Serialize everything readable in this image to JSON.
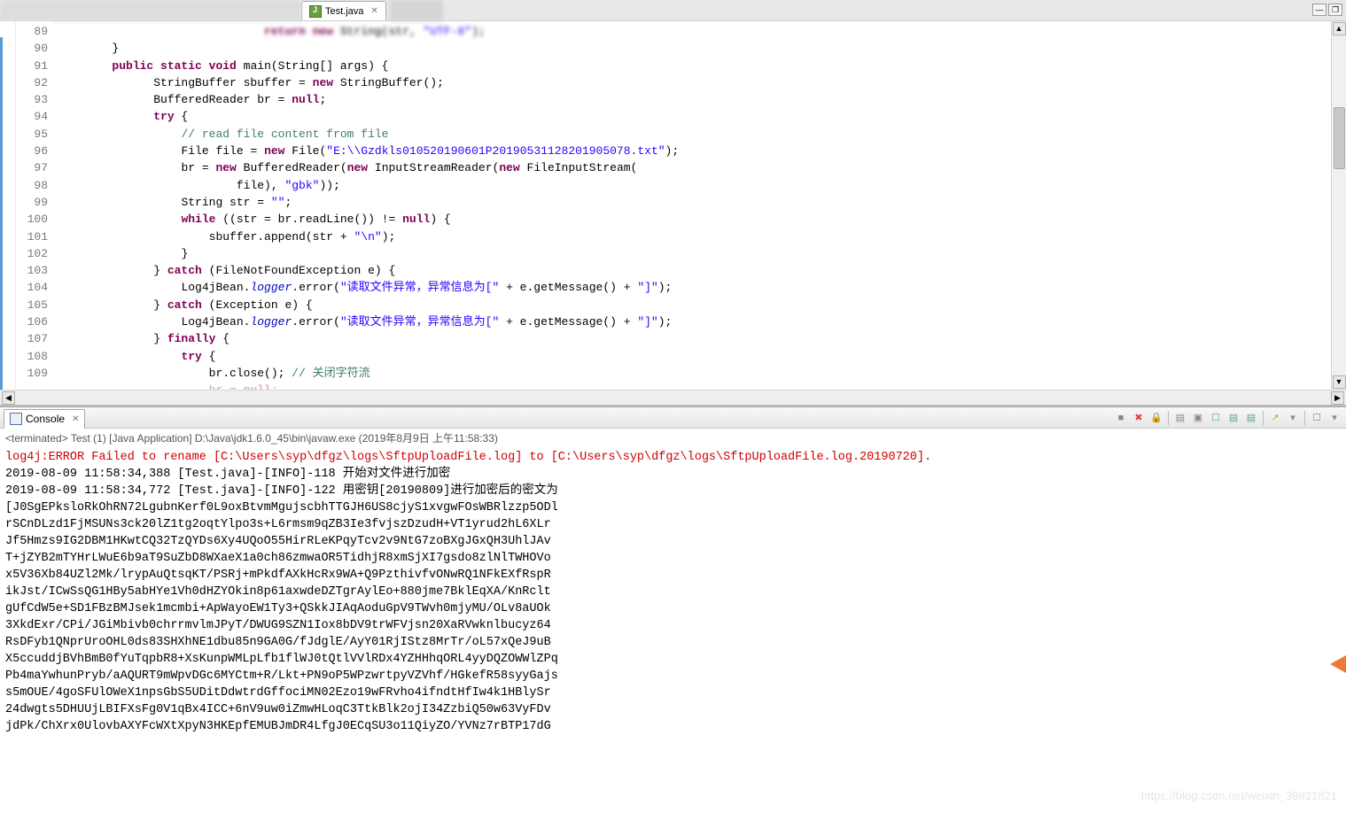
{
  "tab": {
    "filename": "Test.java",
    "close_glyph": "✕"
  },
  "window_controls": {
    "minimize": "—",
    "restore": "❐"
  },
  "editor": {
    "line_numbers": [
      "",
      "89",
      "90",
      "91",
      "92",
      "93",
      "94",
      "95",
      "96",
      "97",
      "98",
      "99",
      "100",
      "101",
      "102",
      "103",
      "104",
      "105",
      "106",
      "107",
      "108",
      "109"
    ],
    "lines": [
      {
        "indent": 24,
        "tokens": [
          {
            "t": "kw",
            "v": "return new"
          },
          {
            "t": "",
            "v": " String(str, "
          },
          {
            "t": "str",
            "v": "\"UTF-8\""
          },
          {
            "t": "",
            "v": ");"
          }
        ],
        "blurred": true
      },
      {
        "indent": 2,
        "tokens": [
          {
            "t": "",
            "v": "}"
          }
        ]
      },
      {
        "indent": 2,
        "tokens": [
          {
            "t": "kw",
            "v": "public static void"
          },
          {
            "t": "",
            "v": " main(String[] args) {"
          }
        ]
      },
      {
        "indent": 8,
        "tokens": [
          {
            "t": "",
            "v": "StringBuffer sbuffer = "
          },
          {
            "t": "kw",
            "v": "new"
          },
          {
            "t": "",
            "v": " StringBuffer();"
          }
        ]
      },
      {
        "indent": 8,
        "tokens": [
          {
            "t": "",
            "v": "BufferedReader br = "
          },
          {
            "t": "kw",
            "v": "null"
          },
          {
            "t": "",
            "v": ";"
          }
        ]
      },
      {
        "indent": 8,
        "tokens": [
          {
            "t": "kw",
            "v": "try"
          },
          {
            "t": "",
            "v": " {"
          }
        ]
      },
      {
        "indent": 12,
        "tokens": [
          {
            "t": "cm",
            "v": "// read file content from file"
          }
        ]
      },
      {
        "indent": 12,
        "tokens": [
          {
            "t": "",
            "v": "File file = "
          },
          {
            "t": "kw",
            "v": "new"
          },
          {
            "t": "",
            "v": " File("
          },
          {
            "t": "str",
            "v": "\"E:\\\\Gzdkls010520190601P20190531128201905078.txt\""
          },
          {
            "t": "",
            "v": ");"
          }
        ]
      },
      {
        "indent": 12,
        "tokens": [
          {
            "t": "",
            "v": "br = "
          },
          {
            "t": "kw",
            "v": "new"
          },
          {
            "t": "",
            "v": " BufferedReader("
          },
          {
            "t": "kw",
            "v": "new"
          },
          {
            "t": "",
            "v": " InputStreamReader("
          },
          {
            "t": "kw",
            "v": "new"
          },
          {
            "t": "",
            "v": " FileInputStream("
          }
        ]
      },
      {
        "indent": 20,
        "tokens": [
          {
            "t": "",
            "v": "file), "
          },
          {
            "t": "str",
            "v": "\"gbk\""
          },
          {
            "t": "",
            "v": "));"
          }
        ]
      },
      {
        "indent": 12,
        "tokens": [
          {
            "t": "",
            "v": "String str = "
          },
          {
            "t": "str",
            "v": "\"\""
          },
          {
            "t": "",
            "v": ";"
          }
        ]
      },
      {
        "indent": 12,
        "tokens": [
          {
            "t": "kw",
            "v": "while"
          },
          {
            "t": "",
            "v": " ((str = br.readLine()) != "
          },
          {
            "t": "kw",
            "v": "null"
          },
          {
            "t": "",
            "v": ") {"
          }
        ]
      },
      {
        "indent": 16,
        "tokens": [
          {
            "t": "",
            "v": "sbuffer.append(str + "
          },
          {
            "t": "str",
            "v": "\"\\n\""
          },
          {
            "t": "",
            "v": ");"
          }
        ]
      },
      {
        "indent": 12,
        "tokens": [
          {
            "t": "",
            "v": "}"
          }
        ]
      },
      {
        "indent": 8,
        "tokens": [
          {
            "t": "",
            "v": "} "
          },
          {
            "t": "kw",
            "v": "catch"
          },
          {
            "t": "",
            "v": " (FileNotFoundException e) {"
          }
        ]
      },
      {
        "indent": 12,
        "tokens": [
          {
            "t": "",
            "v": "Log4jBean."
          },
          {
            "t": "fld",
            "v": "logger"
          },
          {
            "t": "",
            "v": ".error("
          },
          {
            "t": "str",
            "v": "\"读取文件异常，异常信息为[\""
          },
          {
            "t": "",
            "v": " + e.getMessage() + "
          },
          {
            "t": "str",
            "v": "\"]\""
          },
          {
            "t": "",
            "v": ");"
          }
        ]
      },
      {
        "indent": 8,
        "tokens": [
          {
            "t": "",
            "v": "} "
          },
          {
            "t": "kw",
            "v": "catch"
          },
          {
            "t": "",
            "v": " (Exception e) {"
          }
        ]
      },
      {
        "indent": 12,
        "tokens": [
          {
            "t": "",
            "v": "Log4jBean."
          },
          {
            "t": "fld",
            "v": "logger"
          },
          {
            "t": "",
            "v": ".error("
          },
          {
            "t": "str",
            "v": "\"读取文件异常，异常信息为[\""
          },
          {
            "t": "",
            "v": " + e.getMessage() + "
          },
          {
            "t": "str",
            "v": "\"]\""
          },
          {
            "t": "",
            "v": ");"
          }
        ]
      },
      {
        "indent": 8,
        "tokens": [
          {
            "t": "",
            "v": "} "
          },
          {
            "t": "kw",
            "v": "finally"
          },
          {
            "t": "",
            "v": " {"
          }
        ]
      },
      {
        "indent": 12,
        "tokens": [
          {
            "t": "kw",
            "v": "try"
          },
          {
            "t": "",
            "v": " {"
          }
        ]
      },
      {
        "indent": 16,
        "tokens": [
          {
            "t": "",
            "v": "br.close(); "
          },
          {
            "t": "cm",
            "v": "// 关闭字符流"
          }
        ]
      },
      {
        "indent": 16,
        "tokens": [
          {
            "t": "",
            "v": "br = "
          },
          {
            "t": "kw",
            "v": "null"
          },
          {
            "t": "",
            "v": ";"
          }
        ],
        "faded": true
      }
    ]
  },
  "console": {
    "tab_label": "Console",
    "close_glyph": "✕",
    "status": "<terminated> Test (1) [Java Application] D:\\Java\\jdk1.6.0_45\\bin\\javaw.exe (2019年8月9日 上午11:58:33)",
    "toolbar_icons": [
      "■",
      "✖",
      "🔒",
      "▤",
      "▣",
      "☐",
      "▤",
      "▤",
      "↗",
      "▾",
      "☐",
      "▾"
    ],
    "output_lines": [
      {
        "cls": "err",
        "text": "log4j:ERROR Failed to rename [C:\\Users\\syp\\dfgz\\logs\\SftpUploadFile.log] to [C:\\Users\\syp\\dfgz\\logs\\SftpUploadFile.log.20190720]."
      },
      {
        "cls": "",
        "text": "2019-08-09 11:58:34,388 [Test.java]-[INFO]-118 开始对文件进行加密"
      },
      {
        "cls": "",
        "text": "2019-08-09 11:58:34,772 [Test.java]-[INFO]-122 用密钥[20190809]进行加密后的密文为"
      },
      {
        "cls": "",
        "text": "[J0SgEPksloRkOhRN72LgubnKerf0L9oxBtvmMgujscbhTTGJH6US8cjyS1xvgwFOsWBRlzzp5ODl"
      },
      {
        "cls": "",
        "text": "rSCnDLzd1FjMSUNs3ck20lZ1tg2oqtYlpo3s+L6rmsm9qZB3Ie3fvjszDzudH+VT1yrud2hL6XLr"
      },
      {
        "cls": "",
        "text": "Jf5Hmzs9IG2DBM1HKwtCQ32TzQYDs6Xy4UQoO55HirRLeKPqyTcv2v9NtG7zoBXgJGxQH3UhlJAv"
      },
      {
        "cls": "",
        "text": "T+jZYB2mTYHrLWuE6b9aT9SuZbD8WXaeX1a0ch86zmwaOR5TidhjR8xmSjXI7gsdo8zlNlTWHOVo"
      },
      {
        "cls": "",
        "text": "x5V36Xb84UZl2Mk/lrypAuQtsqKT/PSRj+mPkdfAXkHcRx9WA+Q9PzthivfvONwRQ1NFkEXfRspR"
      },
      {
        "cls": "",
        "text": "ikJst/ICwSsQG1HBy5abHYe1Vh0dHZYOkin8p61axwdeDZTgrAylEo+880jme7BklEqXA/KnRclt"
      },
      {
        "cls": "",
        "text": "gUfCdW5e+SD1FBzBMJsek1mcmbi+ApWayoEW1Ty3+QSkkJIAqAoduGpV9TWvh0mjyMU/OLv8aUOk"
      },
      {
        "cls": "",
        "text": "3XkdExr/CPi/JGiMbivb0chrrmvlmJPyT/DWUG9SZN1Iox8bDV9trWFVjsn20XaRVwknlbucyz64"
      },
      {
        "cls": "",
        "text": "RsDFyb1QNprUroOHL0ds83SHXhNE1dbu85n9GA0G/fJdglE/AyY01RjIStz8MrTr/oL57xQeJ9uB"
      },
      {
        "cls": "",
        "text": "X5ccuddjBVhBmB0fYuTqpbR8+XsKunpWMLpLfb1flWJ0tQtlVVlRDx4YZHHhqORL4yyDQZOWWlZPq"
      },
      {
        "cls": "",
        "text": "Pb4maYwhunPryb/aAQURT9mWpvDGc6MYCtm+R/Lkt+PN9oP5WPzwrtpyVZVhf/HGkefR58syyGajs"
      },
      {
        "cls": "",
        "text": "s5mOUE/4goSFUlOWeX1npsGbS5UDitDdwtrdGffociMN02Ezo19wFRvho4ifndtHfIw4k1HBlySr"
      },
      {
        "cls": "",
        "text": "24dwgts5DHUUjLBIFXsFg0V1qBx4ICC+6nV9uw0iZmwHLoqC3TtkBlk2ojI34ZzbiQ50w63VyFDv"
      },
      {
        "cls": "",
        "text": "jdPk/ChXrx0UlovbAXYFcWXtXpyN3HKEpfEMUBJmDR4LfgJ0ECqSU3o11QiyZO/YVNz7rBTP17dG"
      }
    ]
  },
  "watermark": "https://blog.csdn.net/weixin_39921821"
}
